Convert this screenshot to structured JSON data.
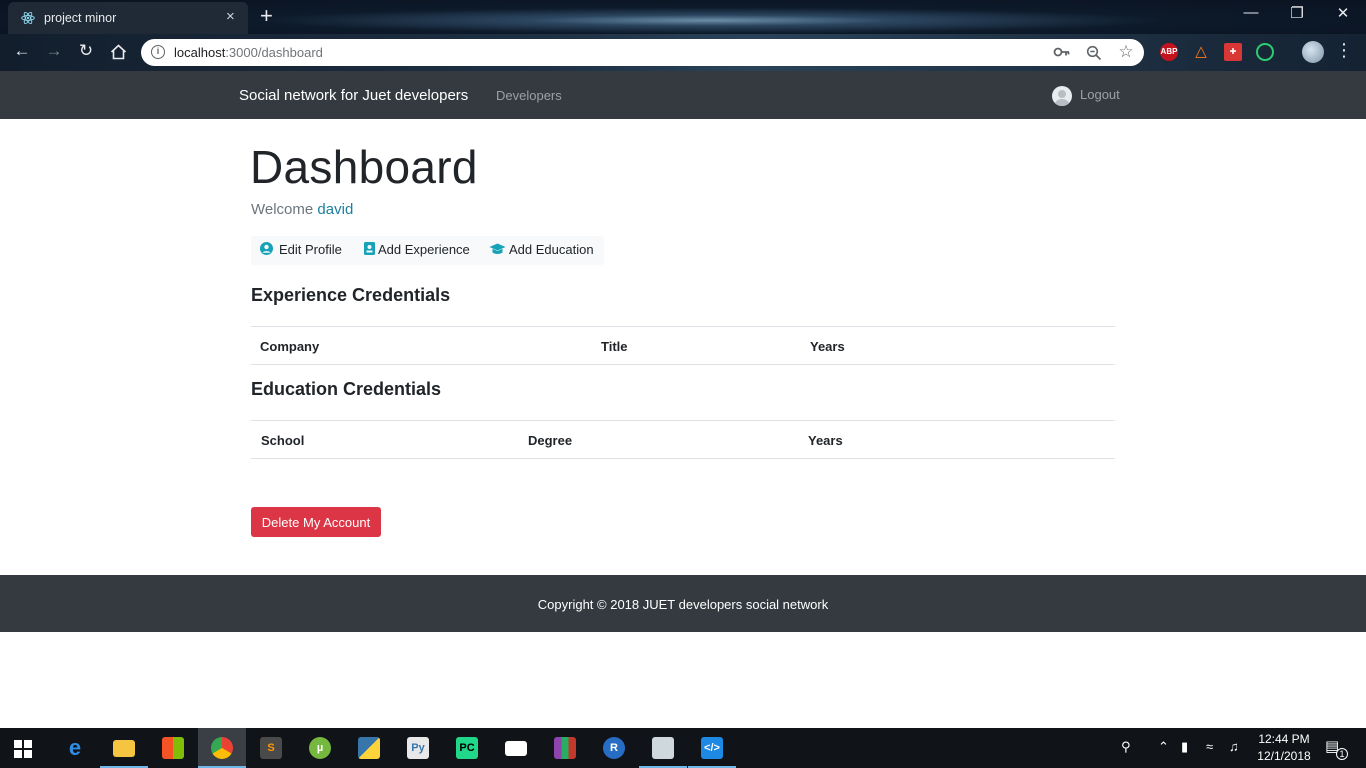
{
  "browser": {
    "tab_title": "project minor",
    "url_host": "localhost",
    "url_path": ":3000/dashboard",
    "new_tab_symbol": "+",
    "close_tab_symbol": "×",
    "extensions": [
      "ABP"
    ]
  },
  "navbar": {
    "brand": "Social network for Juet developers",
    "developers_link": "Developers",
    "logout_link": "Logout"
  },
  "dashboard": {
    "title": "Dashboard",
    "welcome_prefix": "Welcome",
    "username": "david",
    "actions": {
      "edit_profile": "Edit Profile",
      "add_experience": "Add Experience",
      "add_education": "Add Education"
    },
    "experience": {
      "heading": "Experience Credentials",
      "columns": [
        "Company",
        "Title",
        "Years"
      ]
    },
    "education": {
      "heading": "Education Credentials",
      "columns": [
        "School",
        "Degree",
        "Years"
      ]
    },
    "delete_button": "Delete My Account"
  },
  "footer": {
    "text": "Copyright © 2018 JUET developers social network"
  },
  "taskbar": {
    "time": "12:44 PM",
    "date": "12/1/2018",
    "notification_count": "1"
  },
  "colors": {
    "navbar_bg": "#343a40",
    "accent_link": "#1b7fa0",
    "icon_accent": "#17a2b8",
    "danger": "#dc3545"
  }
}
